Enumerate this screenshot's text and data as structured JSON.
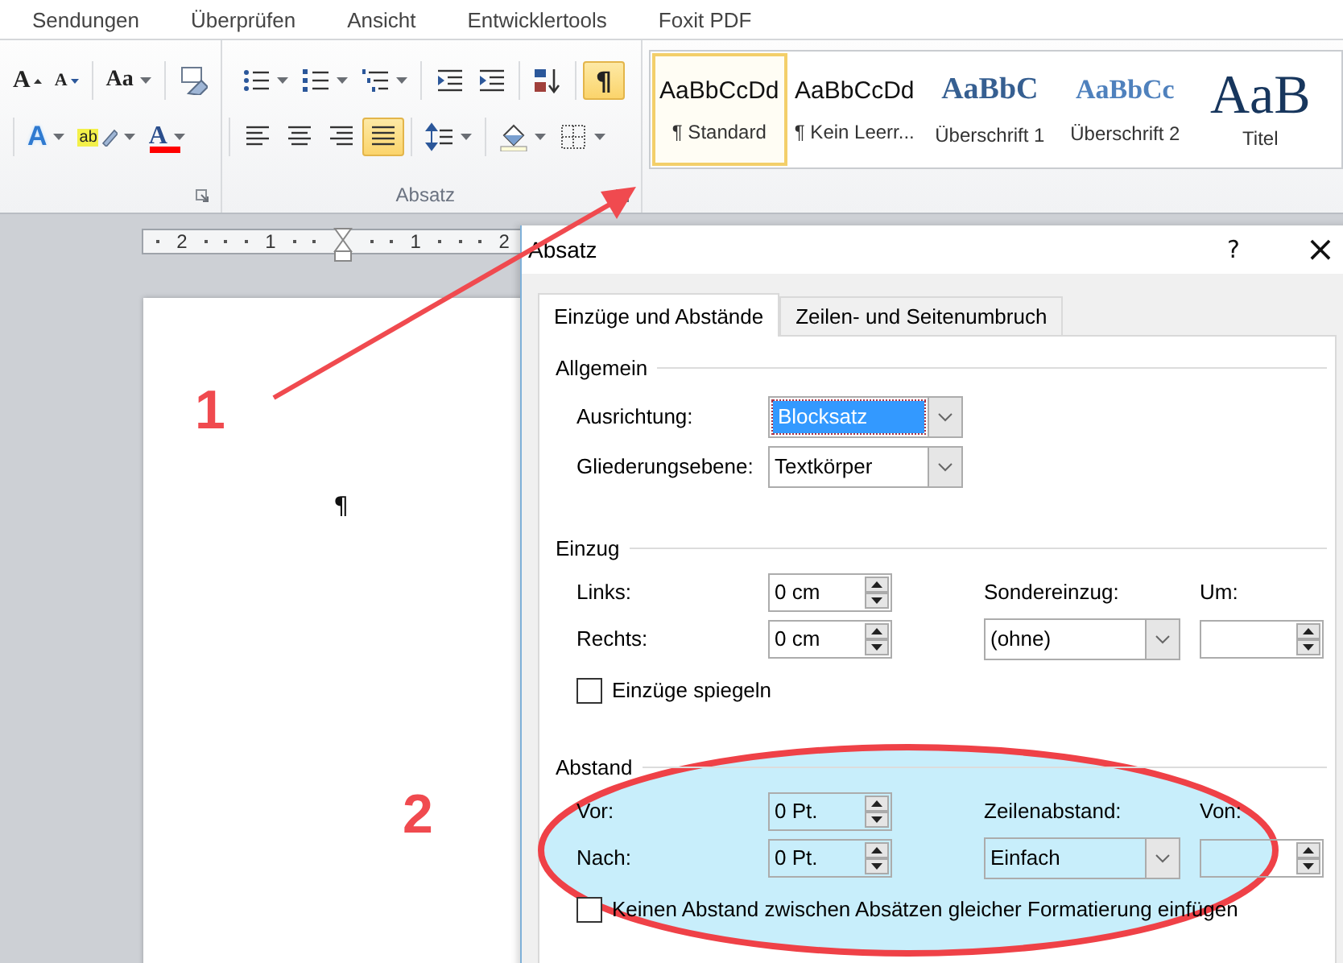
{
  "ribbon_tabs": [
    "Sendungen",
    "Überprüfen",
    "Ansicht",
    "Entwicklertools",
    "Foxit PDF"
  ],
  "font_group": {
    "row1": [
      [
        {
          "kind": "grow",
          "text": "A"
        },
        {
          "kind": "shrink",
          "text": "A"
        }
      ],
      [
        {
          "kind": "case",
          "text": "Aa",
          "dropdown": true
        }
      ],
      [
        {
          "kind": "clear"
        }
      ]
    ],
    "row2": [
      [
        {
          "kind": "effects",
          "text": "A",
          "dropdown": true
        },
        {
          "kind": "highlight",
          "text": "ab",
          "dropdown": true
        },
        {
          "kind": "color",
          "text": "A",
          "dropdown": true
        }
      ]
    ]
  },
  "paragraph_group": {
    "label": "Absatz",
    "row1": [
      [
        {
          "kind": "bullets",
          "dropdown": true,
          "selected": false
        },
        {
          "kind": "numbering",
          "dropdown": true,
          "selected": false
        },
        {
          "kind": "multilevel",
          "dropdown": true,
          "selected": false
        }
      ],
      [
        {
          "kind": "outdent",
          "selected": false
        },
        {
          "kind": "indent",
          "selected": false
        }
      ],
      [
        {
          "kind": "sort",
          "selected": false
        }
      ],
      [
        {
          "kind": "marks",
          "text": "¶",
          "selected": true
        }
      ]
    ],
    "row2": [
      [
        {
          "kind": "align-left",
          "selected": false
        },
        {
          "kind": "align-center",
          "selected": false
        },
        {
          "kind": "align-right",
          "selected": false
        },
        {
          "kind": "justify",
          "selected": true
        }
      ],
      [
        {
          "kind": "spacing",
          "dropdown": true,
          "selected": false
        }
      ],
      [
        {
          "kind": "shading",
          "dropdown": true,
          "selected": false
        },
        {
          "kind": "borders",
          "dropdown": true,
          "selected": false
        }
      ]
    ]
  },
  "styles": [
    {
      "preview": "AaBbCcDd",
      "name": "¶ Standard",
      "kind": "normal",
      "selected": true
    },
    {
      "preview": "AaBbCcDd",
      "name": "¶ Kein Leerr...",
      "kind": "normal",
      "selected": false
    },
    {
      "preview": "AaBbC",
      "name": "Überschrift 1",
      "kind": "heading1",
      "selected": false
    },
    {
      "preview": "AaBbCc",
      "name": "Überschrift 2",
      "kind": "heading2",
      "selected": false
    },
    {
      "preview": "AaB",
      "name": "Titel",
      "kind": "title",
      "selected": false
    }
  ],
  "ruler": {
    "numbers": [
      "2",
      "1",
      "1",
      "2"
    ]
  },
  "document": {
    "paragraph_mark": "¶"
  },
  "dialog": {
    "title": "Absatz",
    "help": "?",
    "close": "×",
    "tabs": [
      {
        "label": "Einzüge und Abstände",
        "selected": true
      },
      {
        "label": "Zeilen- und Seitenumbruch",
        "selected": false
      }
    ],
    "allgemein": {
      "heading": "Allgemein",
      "fields": [
        {
          "label": "Ausrichtung:",
          "value": "Blocksatz",
          "highlighted": true
        },
        {
          "label": "Gliederungsebene:",
          "value": "Textkörper",
          "highlighted": false
        }
      ]
    },
    "einzug": {
      "heading": "Einzug",
      "left": {
        "label": "Links:",
        "value": "0 cm"
      },
      "right": {
        "label": "Rechts:",
        "value": "0 cm"
      },
      "special": {
        "label": "Sondereinzug:",
        "value": "(ohne)"
      },
      "by": {
        "label": "Um:"
      },
      "mirror": {
        "label": "Einzüge spiegeln",
        "checked": false
      }
    },
    "abstand": {
      "heading": "Abstand",
      "before": {
        "label": "Vor:",
        "value": "0 Pt."
      },
      "after": {
        "label": "Nach:",
        "value": "0 Pt."
      },
      "line": {
        "label": "Zeilenabstand:",
        "value": "Einfach"
      },
      "at": {
        "label": "Von:"
      },
      "no_space": {
        "label": "Keinen Abstand zwischen Absätzen gleicher Formatierung einfügen",
        "checked": false
      }
    }
  },
  "annotations": {
    "labels": [
      "1",
      "2"
    ]
  }
}
